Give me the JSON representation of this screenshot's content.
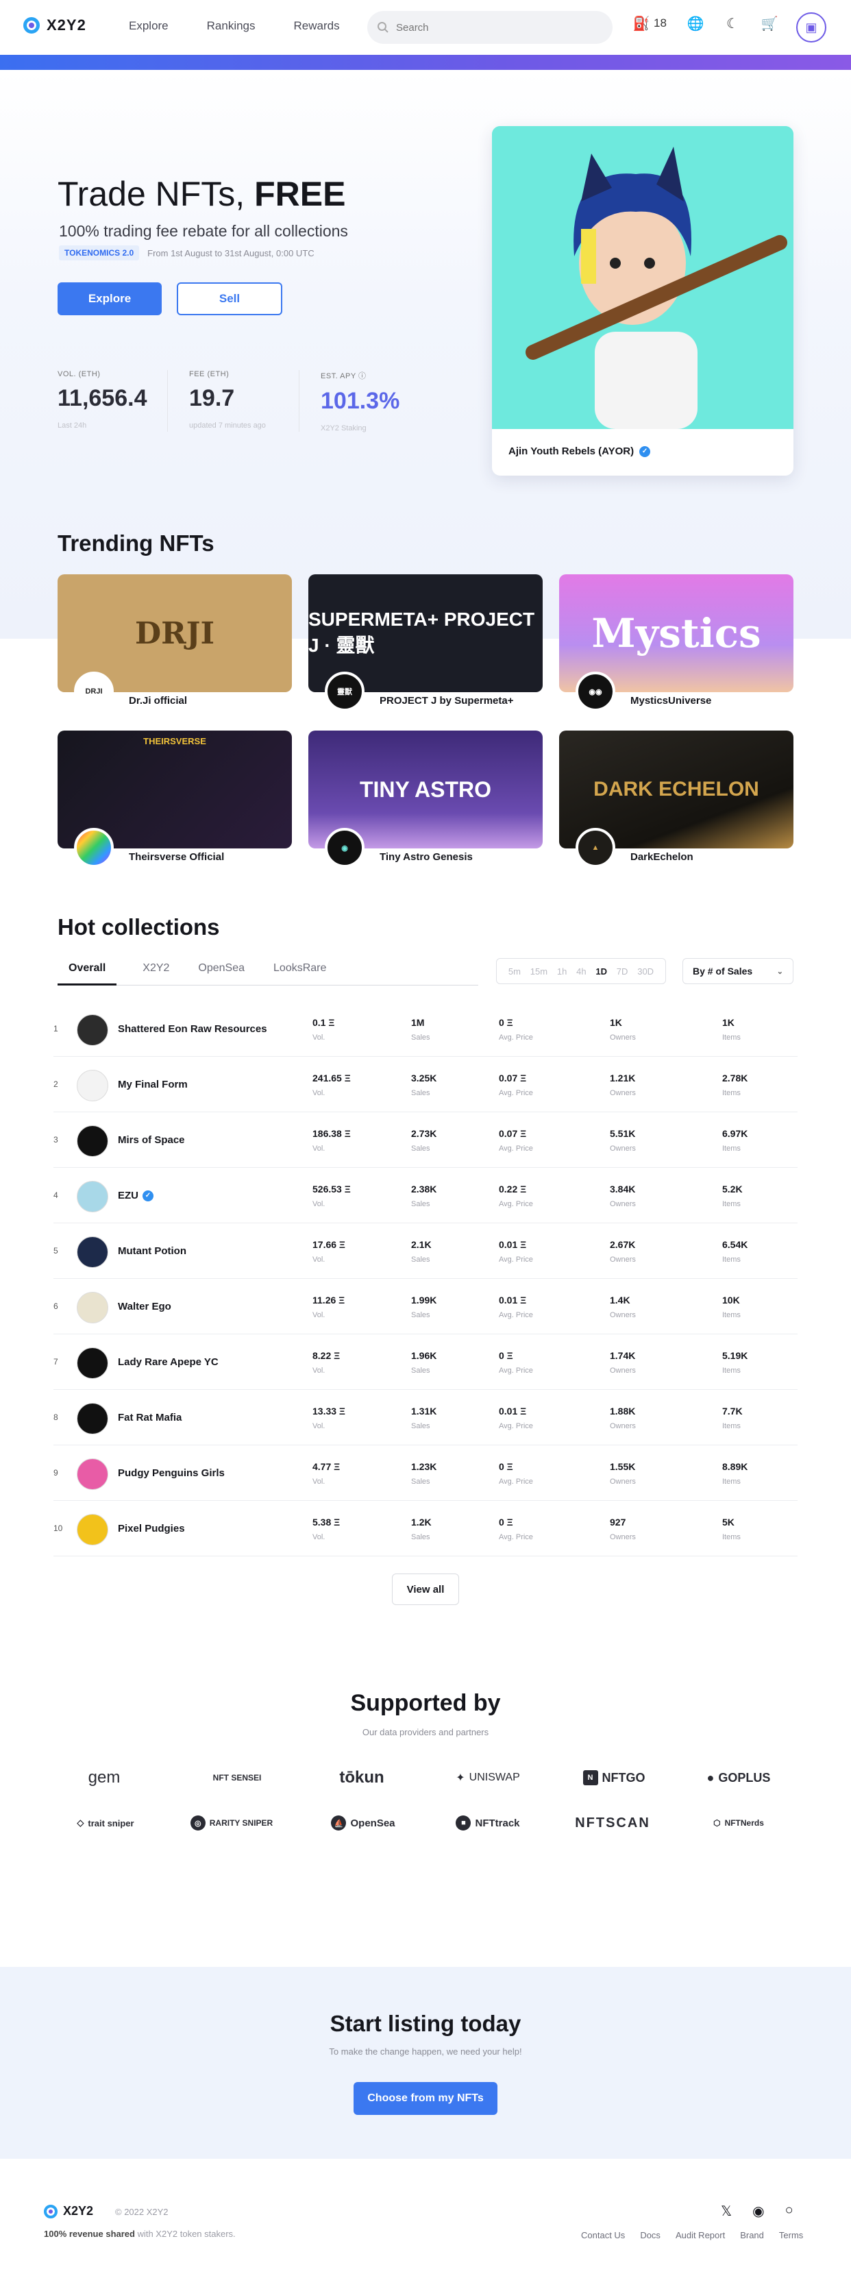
{
  "header": {
    "logo_text": "X2Y2",
    "nav": [
      "Explore",
      "Rankings",
      "Rewards"
    ],
    "search_placeholder": "Search",
    "gas_value": "18"
  },
  "hero": {
    "title_light": "Trade NFTs, ",
    "title_bold": "FREE",
    "subtitle": "100% trading fee rebate for all collections",
    "badge": "TOKENOMICS 2.0",
    "period": "From 1st August to 31st August, 0:00 UTC",
    "explore_label": "Explore",
    "sell_label": "Sell",
    "stats": [
      {
        "label": "VOL. (ETH)",
        "value": "11,656.4",
        "sub": "Last 24h"
      },
      {
        "label": "FEE (ETH)",
        "value": "19.7",
        "sub": "updated 7 minutes ago"
      },
      {
        "label": "EST. APY ⓘ",
        "value": "101.3%",
        "sub": "X2Y2 Staking"
      }
    ],
    "card_caption": "Ajin Youth Rebels (AYOR)"
  },
  "trending": {
    "title": "Trending NFTs",
    "items": [
      {
        "name": "Dr.Ji official",
        "banner": "DRJI",
        "avatar": "DRJI",
        "bg": "#c9a46a"
      },
      {
        "name": "PROJECT J by Supermeta+",
        "banner": "SUPERMETA+ PROJECT J · 靈獸",
        "avatar": "靈獸",
        "bg": "#1b1d26"
      },
      {
        "name": "MysticsUniverse",
        "banner": "Mystics",
        "avatar": "◉◉",
        "bg": "#b98ef0"
      },
      {
        "name": "Theirsverse Official",
        "banner": "THEIRSVERSE",
        "avatar": "",
        "bg": "#1a1a22"
      },
      {
        "name": "Tiny Astro Genesis",
        "banner": "TINY ASTRO",
        "avatar": "◉",
        "bg": "#5a3f96"
      },
      {
        "name": "DarkEchelon",
        "banner": "DARK ECHELON",
        "avatar": "▲",
        "bg": "#1e1c18"
      }
    ]
  },
  "hot": {
    "title": "Hot collections",
    "tabs": [
      "Overall",
      "X2Y2",
      "OpenSea",
      "LooksRare"
    ],
    "timeframes": [
      "5m",
      "15m",
      "1h",
      "4h",
      "1D",
      "7D",
      "30D"
    ],
    "sort_label": "By # of Sales",
    "col_labels": [
      "Vol.",
      "Sales",
      "Avg. Price",
      "Owners",
      "Items"
    ],
    "rows": [
      {
        "rank": "1",
        "name": "Shattered Eon Raw Resources",
        "vol": "0.1 Ξ",
        "sales": "1M",
        "avg": "0 Ξ",
        "owners": "1K",
        "items": "1K",
        "color": "#2c2c2c",
        "verified": false
      },
      {
        "rank": "2",
        "name": "My Final Form",
        "vol": "241.65 Ξ",
        "sales": "3.25K",
        "avg": "0.07 Ξ",
        "owners": "1.21K",
        "items": "2.78K",
        "color": "#f3f3f3",
        "verified": false
      },
      {
        "rank": "3",
        "name": "Mirs of Space",
        "vol": "186.38 Ξ",
        "sales": "2.73K",
        "avg": "0.07 Ξ",
        "owners": "5.51K",
        "items": "6.97K",
        "color": "#111111",
        "verified": false
      },
      {
        "rank": "4",
        "name": "EZU",
        "vol": "526.53 Ξ",
        "sales": "2.38K",
        "avg": "0.22 Ξ",
        "owners": "3.84K",
        "items": "5.2K",
        "color": "#a8d8e8",
        "verified": true
      },
      {
        "rank": "5",
        "name": "Mutant Potion",
        "vol": "17.66 Ξ",
        "sales": "2.1K",
        "avg": "0.01 Ξ",
        "owners": "2.67K",
        "items": "6.54K",
        "color": "#1d2a4a",
        "verified": false
      },
      {
        "rank": "6",
        "name": "Walter Ego",
        "vol": "11.26 Ξ",
        "sales": "1.99K",
        "avg": "0.01 Ξ",
        "owners": "1.4K",
        "items": "10K",
        "color": "#e9e3cf",
        "verified": false
      },
      {
        "rank": "7",
        "name": "Lady Rare Apepe YC",
        "vol": "8.22 Ξ",
        "sales": "1.96K",
        "avg": "0 Ξ",
        "owners": "1.74K",
        "items": "5.19K",
        "color": "#111111",
        "verified": false
      },
      {
        "rank": "8",
        "name": "Fat Rat Mafia",
        "vol": "13.33 Ξ",
        "sales": "1.31K",
        "avg": "0.01 Ξ",
        "owners": "1.88K",
        "items": "7.7K",
        "color": "#111111",
        "verified": false
      },
      {
        "rank": "9",
        "name": "Pudgy Penguins Girls",
        "vol": "4.77 Ξ",
        "sales": "1.23K",
        "avg": "0 Ξ",
        "owners": "1.55K",
        "items": "8.89K",
        "color": "#e85ca6",
        "verified": false
      },
      {
        "rank": "10",
        "name": "Pixel Pudgies",
        "vol": "5.38 Ξ",
        "sales": "1.2K",
        "avg": "0 Ξ",
        "owners": "927",
        "items": "5K",
        "color": "#f2c21b",
        "verified": false
      }
    ],
    "view_all": "View all"
  },
  "supported": {
    "title": "Supported by",
    "subtitle": "Our data providers and partners",
    "partners": [
      "gem",
      "NFT SENSEI",
      "tōkun",
      "UNISWAP",
      "NFTGO",
      "GOPLUS",
      "trait sniper",
      "RARITY SNIPER",
      "OpenSea",
      "NFTtrack",
      "NFTSCAN",
      "NFTNerds"
    ]
  },
  "cta": {
    "title": "Start listing today",
    "subtitle": "To make the change happen, we need your help!",
    "button": "Choose from my NFTs"
  },
  "footer": {
    "logo_text": "X2Y2",
    "copyright": "© 2022 X2Y2",
    "revenue_strong": "100% revenue shared",
    "revenue_rest": " with X2Y2 token stakers.",
    "links": [
      "Contact Us",
      "Docs",
      "Audit Report",
      "Brand",
      "Terms"
    ]
  }
}
